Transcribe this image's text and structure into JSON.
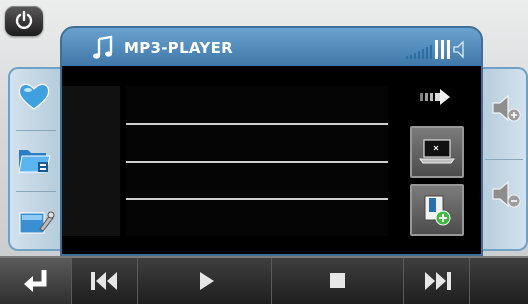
{
  "app": {
    "title": "MP3-PLAYER"
  },
  "icons": {
    "power": "power-icon",
    "title": "music-note-icon",
    "favorites": "heart-icon",
    "folder": "folder-icon",
    "settings": "settings-tools-icon",
    "volume_up": "speaker-plus-icon",
    "volume_down": "speaker-minus-icon",
    "volume_level": "speaker-icon",
    "next_view": "arrow-right-icon",
    "screen": "laptop-icon",
    "add": "document-add-icon",
    "back": "return-arrow-icon",
    "previous": "skip-previous-icon",
    "play": "play-icon",
    "stop": "stop-icon",
    "next": "skip-next-icon"
  },
  "volume": {
    "level": 0.7
  },
  "colors": {
    "accent": "#5b93c1",
    "panel": "#c7d8e6",
    "bottom_bar": "#262626"
  }
}
